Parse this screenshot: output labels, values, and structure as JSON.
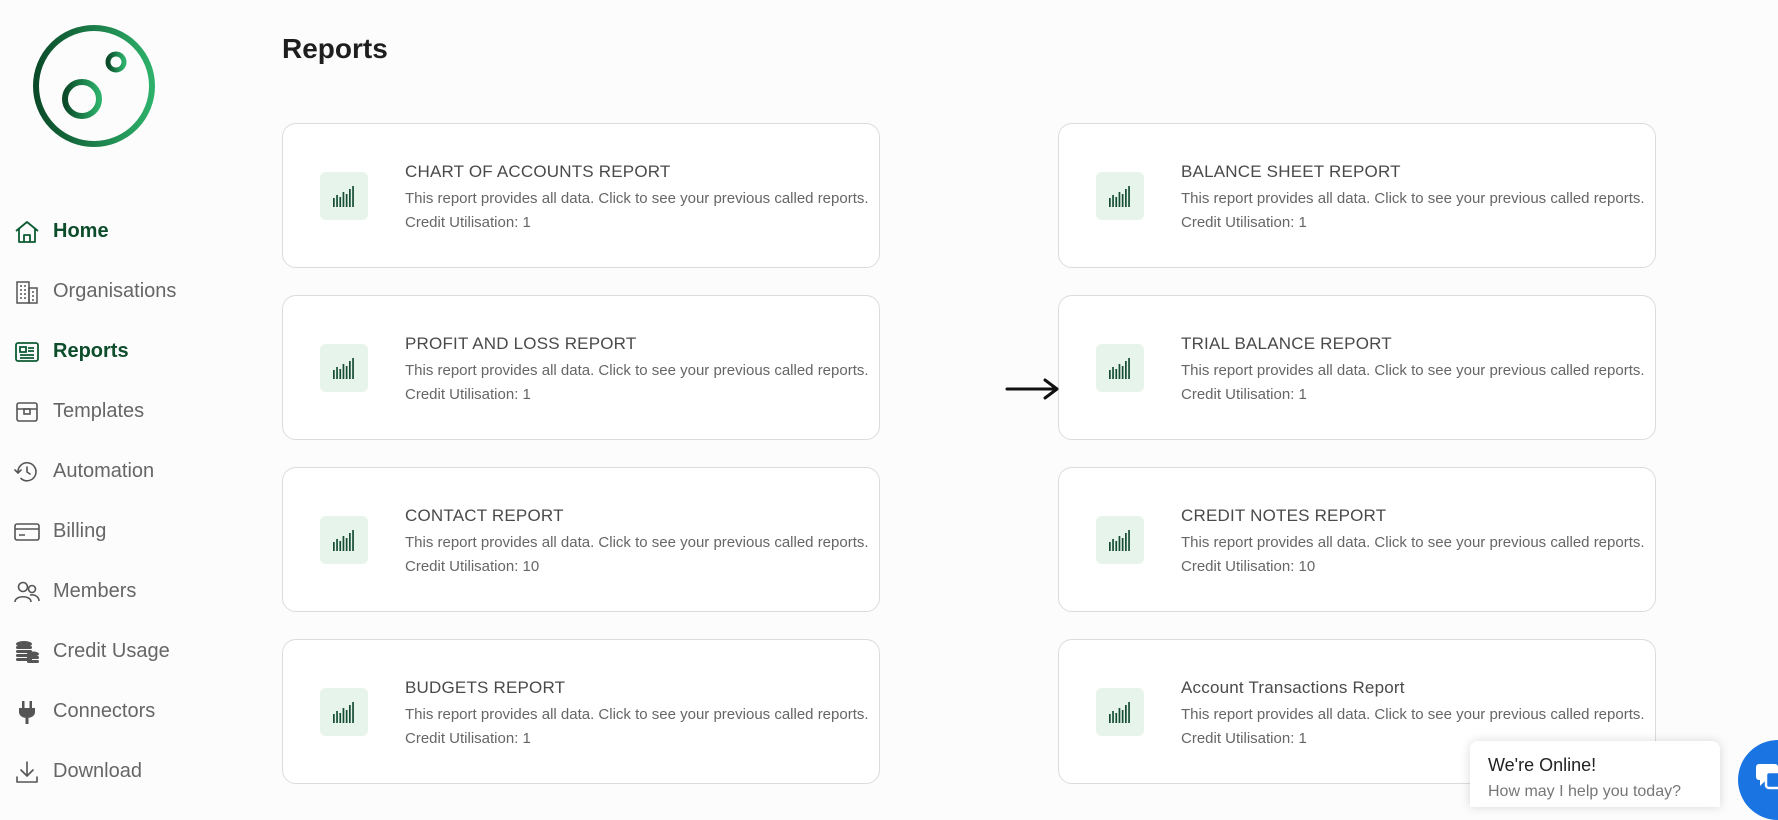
{
  "sidebar": {
    "items": [
      {
        "label": "Home",
        "icon": "home-icon",
        "active": true
      },
      {
        "label": "Organisations",
        "icon": "building-icon",
        "active": false
      },
      {
        "label": "Reports",
        "icon": "report-icon",
        "active": true
      },
      {
        "label": "Templates",
        "icon": "template-icon",
        "active": false
      },
      {
        "label": "Automation",
        "icon": "history-icon",
        "active": false
      },
      {
        "label": "Billing",
        "icon": "credit-card-icon",
        "active": false
      },
      {
        "label": "Members",
        "icon": "users-icon",
        "active": false
      },
      {
        "label": "Credit Usage",
        "icon": "coins-icon",
        "active": false
      },
      {
        "label": "Connectors",
        "icon": "plug-icon",
        "active": false
      },
      {
        "label": "Download",
        "icon": "download-icon",
        "active": false
      }
    ]
  },
  "page": {
    "title": "Reports"
  },
  "reports": [
    {
      "title": "CHART OF ACCOUNTS REPORT",
      "description": "This report provides all data. Click to see your previous called reports.",
      "credit": "Credit Utilisation: 1"
    },
    {
      "title": "BALANCE SHEET REPORT",
      "description": "This report provides all data. Click to see your previous called reports.",
      "credit": "Credit Utilisation: 1"
    },
    {
      "title": "PROFIT AND LOSS REPORT",
      "description": "This report provides all data. Click to see your previous called reports.",
      "credit": "Credit Utilisation: 1"
    },
    {
      "title": "TRIAL BALANCE REPORT",
      "description": "This report provides all data. Click to see your previous called reports.",
      "credit": "Credit Utilisation: 1"
    },
    {
      "title": "CONTACT REPORT",
      "description": "This report provides all data. Click to see your previous called reports.",
      "credit": "Credit Utilisation: 10"
    },
    {
      "title": "CREDIT NOTES REPORT",
      "description": "This report provides all data. Click to see your previous called reports.",
      "credit": "Credit Utilisation: 10"
    },
    {
      "title": "BUDGETS REPORT",
      "description": "This report provides all data. Click to see your previous called reports.",
      "credit": "Credit Utilisation: 1"
    },
    {
      "title": "Account Transactions Report",
      "description": "This report provides all data. Click to see your previous called reports.",
      "credit": "Credit Utilisation: 1"
    }
  ],
  "chat": {
    "title": "We're Online!",
    "subtitle": "How may I help you today?"
  },
  "colors": {
    "brand_dark": "#0d5b33",
    "brand_light": "#2db16a",
    "icon_bg": "#e6f4ec",
    "chat_blue": "#1a74e2"
  }
}
